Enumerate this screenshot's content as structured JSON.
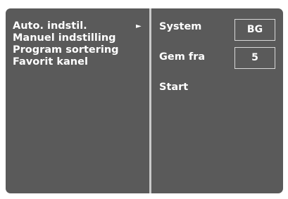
{
  "menu": {
    "items": [
      {
        "label": "Auto. indstil.",
        "arrow": "►"
      },
      {
        "label": "Manuel indstilling"
      },
      {
        "label": "Program sortering"
      },
      {
        "label": "Favorit kanel"
      }
    ]
  },
  "options": {
    "system": {
      "label": "System",
      "value": "BG"
    },
    "gem_fra": {
      "label": "Gem fra",
      "value": "5"
    },
    "start": {
      "label": "Start"
    }
  },
  "colors": {
    "panel_background": "#5a5a5a",
    "divider": "#c9c9c9",
    "text": "#ffffff"
  }
}
